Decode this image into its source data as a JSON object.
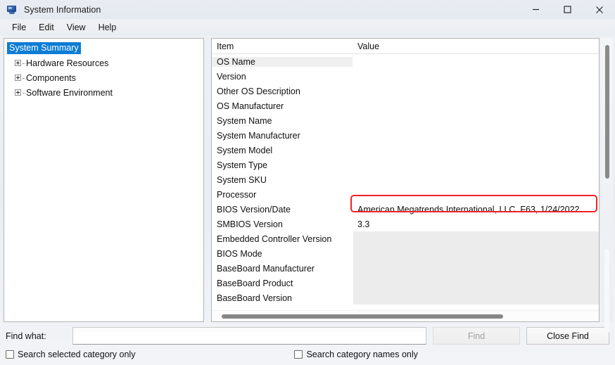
{
  "window": {
    "title": "System Information",
    "icon": "system-information-icon",
    "controls": {
      "minimize": "minimize-icon",
      "maximize": "maximize-icon",
      "close": "close-icon"
    }
  },
  "menubar": {
    "items": [
      {
        "label": "File"
      },
      {
        "label": "Edit"
      },
      {
        "label": "View"
      },
      {
        "label": "Help"
      }
    ]
  },
  "tree": {
    "items": [
      {
        "label": "System Summary",
        "selected": true,
        "expandable": false
      },
      {
        "label": "Hardware Resources",
        "selected": false,
        "expandable": true
      },
      {
        "label": "Components",
        "selected": false,
        "expandable": true
      },
      {
        "label": "Software Environment",
        "selected": false,
        "expandable": true
      }
    ]
  },
  "list": {
    "columns": [
      {
        "label": "Item"
      },
      {
        "label": "Value"
      }
    ],
    "rows": [
      {
        "item": "OS Name",
        "value": "",
        "selected": true
      },
      {
        "item": "Version",
        "value": "",
        "selected": false
      },
      {
        "item": "Other OS Description",
        "value": "",
        "selected": false
      },
      {
        "item": "OS Manufacturer",
        "value": "",
        "selected": false
      },
      {
        "item": "System Name",
        "value": "",
        "selected": false
      },
      {
        "item": "System Manufacturer",
        "value": "",
        "selected": false
      },
      {
        "item": "System Model",
        "value": "",
        "selected": false
      },
      {
        "item": "System Type",
        "value": "",
        "selected": false
      },
      {
        "item": "System SKU",
        "value": "",
        "selected": false
      },
      {
        "item": "Processor",
        "value": "",
        "selected": false
      },
      {
        "item": "BIOS Version/Date",
        "value": "American Megatrends International, LLC. F63, 1/24/2022",
        "selected": false
      },
      {
        "item": "SMBIOS Version",
        "value": "3.3",
        "selected": false
      },
      {
        "item": "Embedded Controller Version",
        "value": "",
        "selected": false
      },
      {
        "item": "BIOS Mode",
        "value": "",
        "selected": false
      },
      {
        "item": "BaseBoard Manufacturer",
        "value": "",
        "selected": false
      },
      {
        "item": "BaseBoard Product",
        "value": "",
        "selected": false
      },
      {
        "item": "BaseBoard Version",
        "value": "",
        "selected": false
      }
    ]
  },
  "annotation": {
    "highlight_color": "#ec2227",
    "target_row": "BIOS Version/Date"
  },
  "findbar": {
    "label": "Find what:",
    "input_value": "",
    "input_placeholder": "",
    "find_button": "Find",
    "find_button_enabled": false,
    "close_find_button": "Close Find"
  },
  "options": {
    "search_selected_category": {
      "label": "Search selected category only",
      "checked": false
    },
    "search_category_names": {
      "label": "Search category names only",
      "checked": false
    }
  },
  "colors": {
    "selection_blue": "#0c7cd5",
    "row_highlight": "#efefef",
    "annotation_red": "#ec2227"
  }
}
